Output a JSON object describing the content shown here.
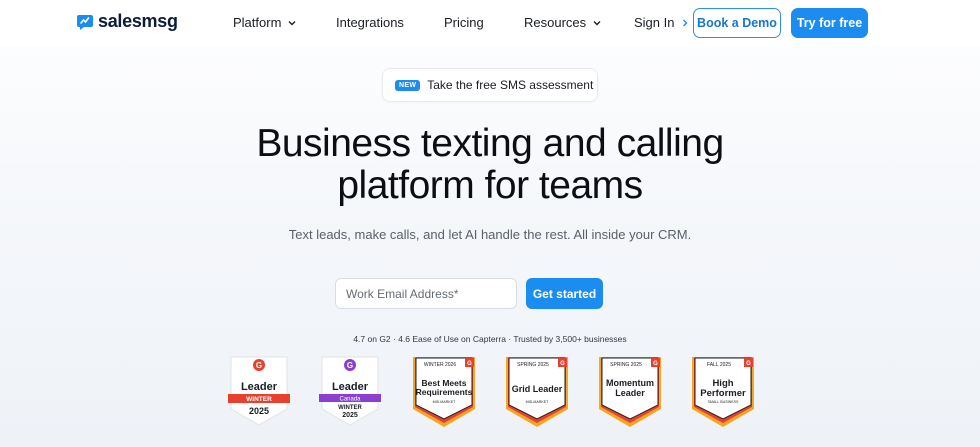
{
  "nav": {
    "logo_text": "salesmsg",
    "links": [
      {
        "label": "Platform",
        "has_dropdown": true
      },
      {
        "label": "Integrations",
        "has_dropdown": false
      },
      {
        "label": "Pricing",
        "has_dropdown": false
      },
      {
        "label": "Resources",
        "has_dropdown": true
      }
    ],
    "sign_in": "Sign In",
    "book_demo": "Book a Demo",
    "try_free": "Try for free"
  },
  "announcement": {
    "badge": "NEW",
    "text": "Take the free SMS assessment"
  },
  "hero": {
    "headline_line1": "Business texting and calling",
    "headline_line2": "platform for teams",
    "subheadline": "Text leads, make calls, and let AI handle the rest. All inside your CRM.",
    "email_placeholder": "Work Email Address*",
    "cta": "Get started",
    "trust_line": "4.7 on G2 · 4.6 Ease of Use on Capterra · Trusted by 3,500+ businesses"
  },
  "badges": [
    {
      "title": "Leader",
      "ribbon": "WINTER",
      "year": "2025",
      "ribbon_color": "#e8402f",
      "mark_color": "#e8402f"
    },
    {
      "title": "Leader",
      "ribbon": "Canada",
      "ribbon2": "WINTER",
      "year": "2025",
      "ribbon_color": "#8a3fd1",
      "mark_color": "#8a3fd1"
    },
    {
      "season": "WINTER 2026",
      "title1": "Best Meets",
      "title2": "Requirements",
      "segment": "MID-MARKET"
    },
    {
      "season": "SPRING 2025",
      "title1": "Grid Leader",
      "title2": "",
      "segment": "MID-MARKET"
    },
    {
      "season": "SPRING 2025",
      "title1": "Momentum",
      "title2": "Leader",
      "segment": ""
    },
    {
      "season": "FALL 2025",
      "title1": "High",
      "title2": "Performer",
      "segment": "SMALL BUSINESS"
    }
  ],
  "colors": {
    "accent": "#1b8cf0",
    "g2_red": "#e8402f",
    "badge_orange": "#f5a623"
  }
}
